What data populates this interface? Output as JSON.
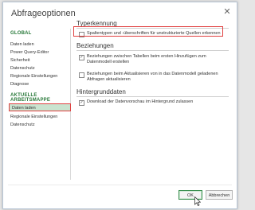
{
  "dialog": {
    "title": "Abfrageoptionen"
  },
  "sidebar": {
    "global_header": "GLOBAL",
    "global_items": [
      "Daten laden",
      "Power Query-Editor",
      "Sicherheit",
      "Datenschutz",
      "Regionale Einstellungen",
      "Diagnose"
    ],
    "workbook_header": "AKTUELLE ARBEITSMAPPE",
    "workbook_items": [
      "Daten laden",
      "Regionale Einstellungen",
      "Datenschutz"
    ],
    "selected_item": "Daten laden"
  },
  "content": {
    "type_detection": {
      "title": "Typerkennung",
      "option_label": "Spaltentypen und -überschriften für unstrukturierte Quellen erkennen",
      "checked": false
    },
    "relationships": {
      "title": "Beziehungen",
      "option1_label": "Beziehungen zwischen Tabellen beim ersten Hinzufügen zum Datenmodell erstellen",
      "option1_checked": true,
      "option2_label": "Beziehungen beim Aktualisieren von in das Datenmodell geladenen Abfragen aktualisieren",
      "option2_checked": false
    },
    "background_data": {
      "title": "Hintergrunddaten",
      "option_label": "Download der Datenvorschau im Hintergrund zulassen",
      "checked": true
    }
  },
  "buttons": {
    "ok": "OK",
    "cancel": "Abbrechen"
  },
  "icons": {
    "close": "close-icon",
    "checkmark": "check-icon"
  },
  "colors": {
    "accent_green": "#2a7a3b",
    "selection_bg": "#c9e3cf",
    "highlight_red": "#e04040"
  }
}
